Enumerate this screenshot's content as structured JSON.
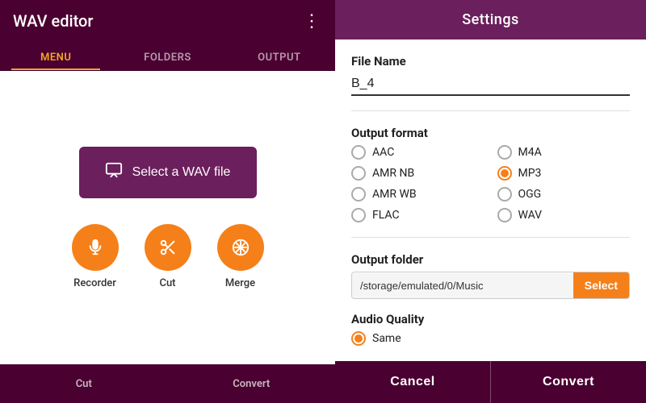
{
  "left": {
    "appbar": {
      "title": "WAV editor",
      "menu_icon": "⋮"
    },
    "tabs": [
      {
        "id": "menu",
        "label": "MENU",
        "active": true
      },
      {
        "id": "folders",
        "label": "FOLDERS",
        "active": false
      },
      {
        "id": "output",
        "label": "OUTPUT",
        "active": false
      }
    ],
    "select_btn_label": "Select a WAV file",
    "bottom_tools": [
      {
        "id": "recorder",
        "label": "Recorder",
        "icon": "🎙"
      },
      {
        "id": "cut",
        "label": "Cut",
        "icon": "✂"
      },
      {
        "id": "merge",
        "label": "Merge",
        "icon": "⊕"
      }
    ],
    "bottom_bar": [
      {
        "id": "cut-bar",
        "label": "Cut"
      },
      {
        "id": "convert-bar",
        "label": "Convert"
      }
    ]
  },
  "right": {
    "header": {
      "title": "Settings"
    },
    "file_name": {
      "label": "File Name",
      "value": "B_4"
    },
    "output_format": {
      "label": "Output format",
      "options": [
        {
          "id": "aac",
          "label": "AAC",
          "checked": false
        },
        {
          "id": "m4a",
          "label": "M4A",
          "checked": false
        },
        {
          "id": "amr_nb",
          "label": "AMR NB",
          "checked": false
        },
        {
          "id": "mp3",
          "label": "MP3",
          "checked": true
        },
        {
          "id": "amr_wb",
          "label": "AMR WB",
          "checked": false
        },
        {
          "id": "ogg",
          "label": "OGG",
          "checked": false
        },
        {
          "id": "flac",
          "label": "FLAC",
          "checked": false
        },
        {
          "id": "wav",
          "label": "WAV",
          "checked": false
        }
      ]
    },
    "output_folder": {
      "label": "Output folder",
      "path": "/storage/emulated/0/Music",
      "select_btn": "Select"
    },
    "audio_quality": {
      "label": "Audio Quality",
      "options": [
        {
          "id": "same",
          "label": "Same",
          "checked": true
        }
      ]
    },
    "footer": {
      "cancel_label": "Cancel",
      "convert_label": "Convert"
    }
  }
}
